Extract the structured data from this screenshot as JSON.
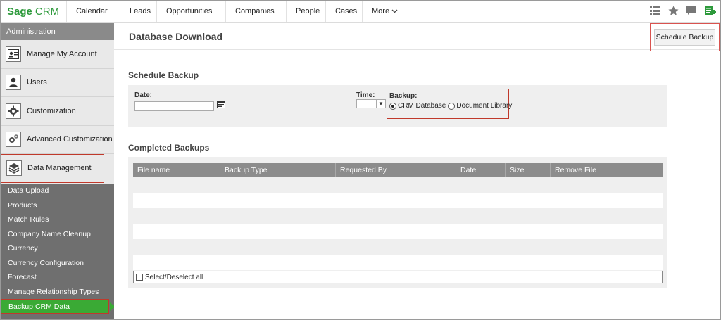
{
  "brand": {
    "name": "Sage",
    "product": "CRM",
    "color": "#2e9a3c"
  },
  "nav": {
    "items": [
      "Calendar",
      "Leads",
      "Opportunities",
      "Companies",
      "People",
      "Cases"
    ],
    "more_label": "More"
  },
  "top_icons": [
    "list-view-icon",
    "star-icon",
    "comment-icon",
    "new-record-icon"
  ],
  "sidebar": {
    "heading": "Administration",
    "main_items": [
      {
        "label": "Manage My Account",
        "icon": "account-card-icon"
      },
      {
        "label": "Users",
        "icon": "user-icon"
      },
      {
        "label": "Customization",
        "icon": "gear-icon"
      },
      {
        "label": "Advanced Customization",
        "icon": "gears-icon"
      },
      {
        "label": "Data Management",
        "icon": "layers-icon"
      }
    ],
    "active_main": "Data Management",
    "sub_items": [
      "Data Upload",
      "Products",
      "Match Rules",
      "Company Name Cleanup",
      "Currency",
      "Currency Configuration",
      "Forecast",
      "Manage Relationship Types",
      "Backup CRM Data"
    ],
    "active_sub": "Backup CRM Data",
    "active_color": "#3aaa35"
  },
  "main": {
    "title": "Database Download",
    "schedule_button": "Schedule Backup",
    "schedule_section": {
      "title": "Schedule Backup",
      "date_label": "Date:",
      "date_value": "",
      "time_label": "Time:",
      "time_value": "",
      "backup_label": "Backup:",
      "options": [
        {
          "label": "CRM Database",
          "selected": true
        },
        {
          "label": "Document Library",
          "selected": false
        }
      ]
    },
    "completed_section": {
      "title": "Completed Backups",
      "columns": [
        "File name",
        "Backup Type",
        "Requested By",
        "Date",
        "Size",
        "Remove File"
      ],
      "rows": [],
      "select_all_label": "Select/Deselect all"
    }
  }
}
